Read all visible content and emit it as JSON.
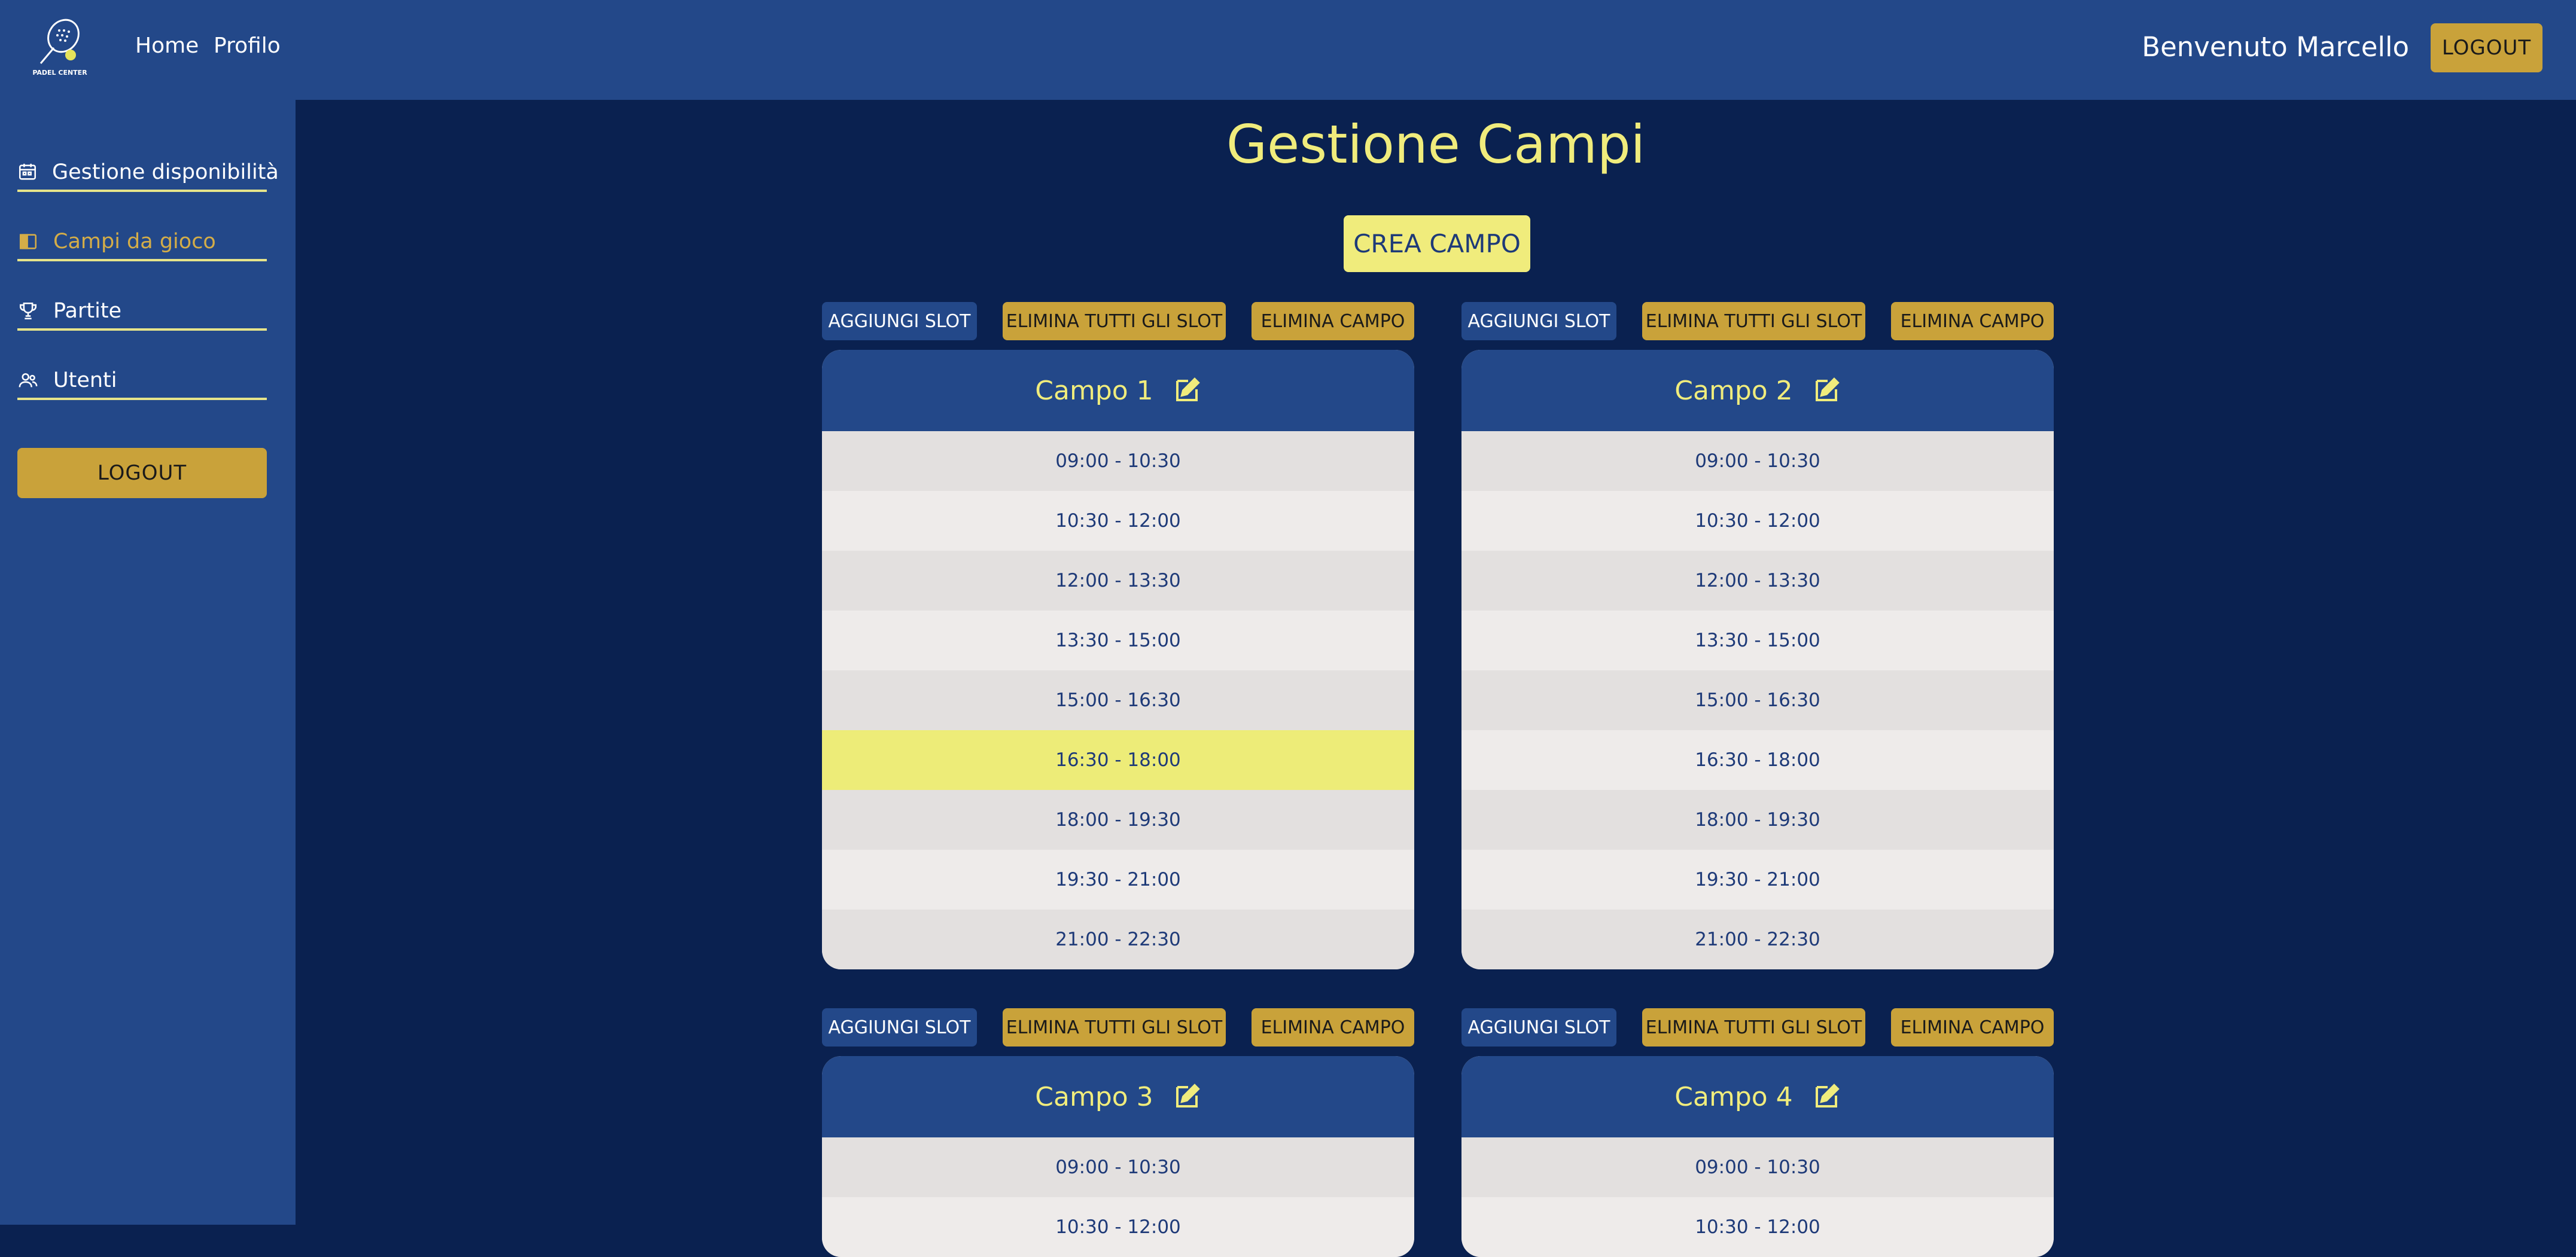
{
  "header": {
    "logo_text": "PADEL CENTER",
    "nav": [
      "Home",
      "Profilo"
    ],
    "welcome": "Benvenuto Marcello",
    "logout_label": "LOGOUT"
  },
  "sidebar": {
    "items": [
      {
        "label": "Gestione disponibilità",
        "icon": "calendar-icon",
        "active": false
      },
      {
        "label": "Campi da gioco",
        "icon": "court-icon",
        "active": true
      },
      {
        "label": "Partite",
        "icon": "trophy-icon",
        "active": false
      },
      {
        "label": "Utenti",
        "icon": "users-icon",
        "active": false
      }
    ],
    "logout_label": "LOGOUT"
  },
  "main": {
    "title": "Gestione Campi",
    "create_label": "CREA CAMPO",
    "actions": {
      "add_slot": "AGGIUNGI SLOT",
      "delete_all_slots": "ELIMINA TUTTI GLI SLOT",
      "delete_court": "ELIMINA CAMPO"
    },
    "courts": [
      {
        "name": "Campo 1",
        "slots": [
          "09:00 - 10:30",
          "10:30 - 12:00",
          "12:00 - 13:30",
          "13:30 - 15:00",
          "15:00 - 16:30",
          "16:30 - 18:00",
          "18:00 - 19:30",
          "19:30 - 21:00",
          "21:00 - 22:30"
        ],
        "highlighted_slot": 5
      },
      {
        "name": "Campo 2",
        "slots": [
          "09:00 - 10:30",
          "10:30 - 12:00",
          "12:00 - 13:30",
          "13:30 - 15:00",
          "15:00 - 16:30",
          "16:30 - 18:00",
          "18:00 - 19:30",
          "19:30 - 21:00",
          "21:00 - 22:30"
        ],
        "highlighted_slot": -1
      },
      {
        "name": "Campo 3",
        "slots": [
          "09:00 - 10:30",
          "10:30 - 12:00"
        ],
        "highlighted_slot": -1
      },
      {
        "name": "Campo 4",
        "slots": [
          "09:00 - 10:30",
          "10:30 - 12:00"
        ],
        "highlighted_slot": -1
      }
    ]
  },
  "colors": {
    "background": "#0a2150",
    "panel": "#234889",
    "accent_yellow": "#f0ec7c",
    "gold": "#c9a23a"
  }
}
